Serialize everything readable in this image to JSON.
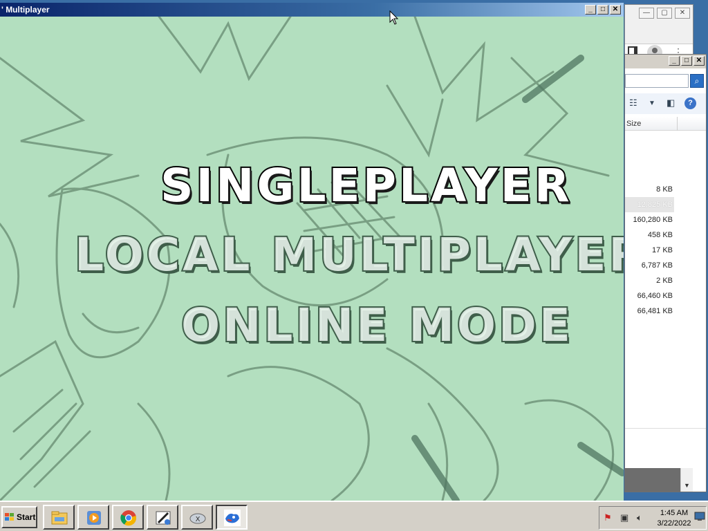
{
  "game_window": {
    "title": "' Multiplayer",
    "controls": {
      "minimize": "_",
      "maximize": "□",
      "close": "✕"
    },
    "menu": [
      {
        "label": "SINGLEPLAYER",
        "selected": true
      },
      {
        "label": "LOCAL MULTIPLAYER",
        "selected": false
      },
      {
        "label": "ONLINE MODE",
        "selected": false
      }
    ],
    "background_color": "#b3dfbf"
  },
  "explorer_window": {
    "column_header": "Size",
    "sizes": [
      {
        "value": "8 KB",
        "selected": false
      },
      {
        "value": "12,825 KB",
        "selected": true
      },
      {
        "value": "160,280 KB",
        "selected": false
      },
      {
        "value": "458 KB",
        "selected": false
      },
      {
        "value": "17 KB",
        "selected": false
      },
      {
        "value": "6,787 KB",
        "selected": false
      },
      {
        "value": "2 KB",
        "selected": false
      },
      {
        "value": "66,460 KB",
        "selected": false
      },
      {
        "value": "66,481 KB",
        "selected": false
      }
    ],
    "icons": [
      "view-options-icon",
      "dropdown-arrow-icon",
      "preview-pane-icon",
      "help-icon",
      "search-icon"
    ]
  },
  "taskbar": {
    "start_label": "Start",
    "apps": [
      {
        "name": "file-explorer-icon"
      },
      {
        "name": "media-player-icon"
      },
      {
        "name": "chrome-icon"
      },
      {
        "name": "paint-tool-icon"
      },
      {
        "name": "xbox-controller-icon"
      },
      {
        "name": "game-app-icon",
        "active": true
      }
    ],
    "tray": {
      "time": "1:45 AM",
      "date": "3/22/2022"
    }
  }
}
